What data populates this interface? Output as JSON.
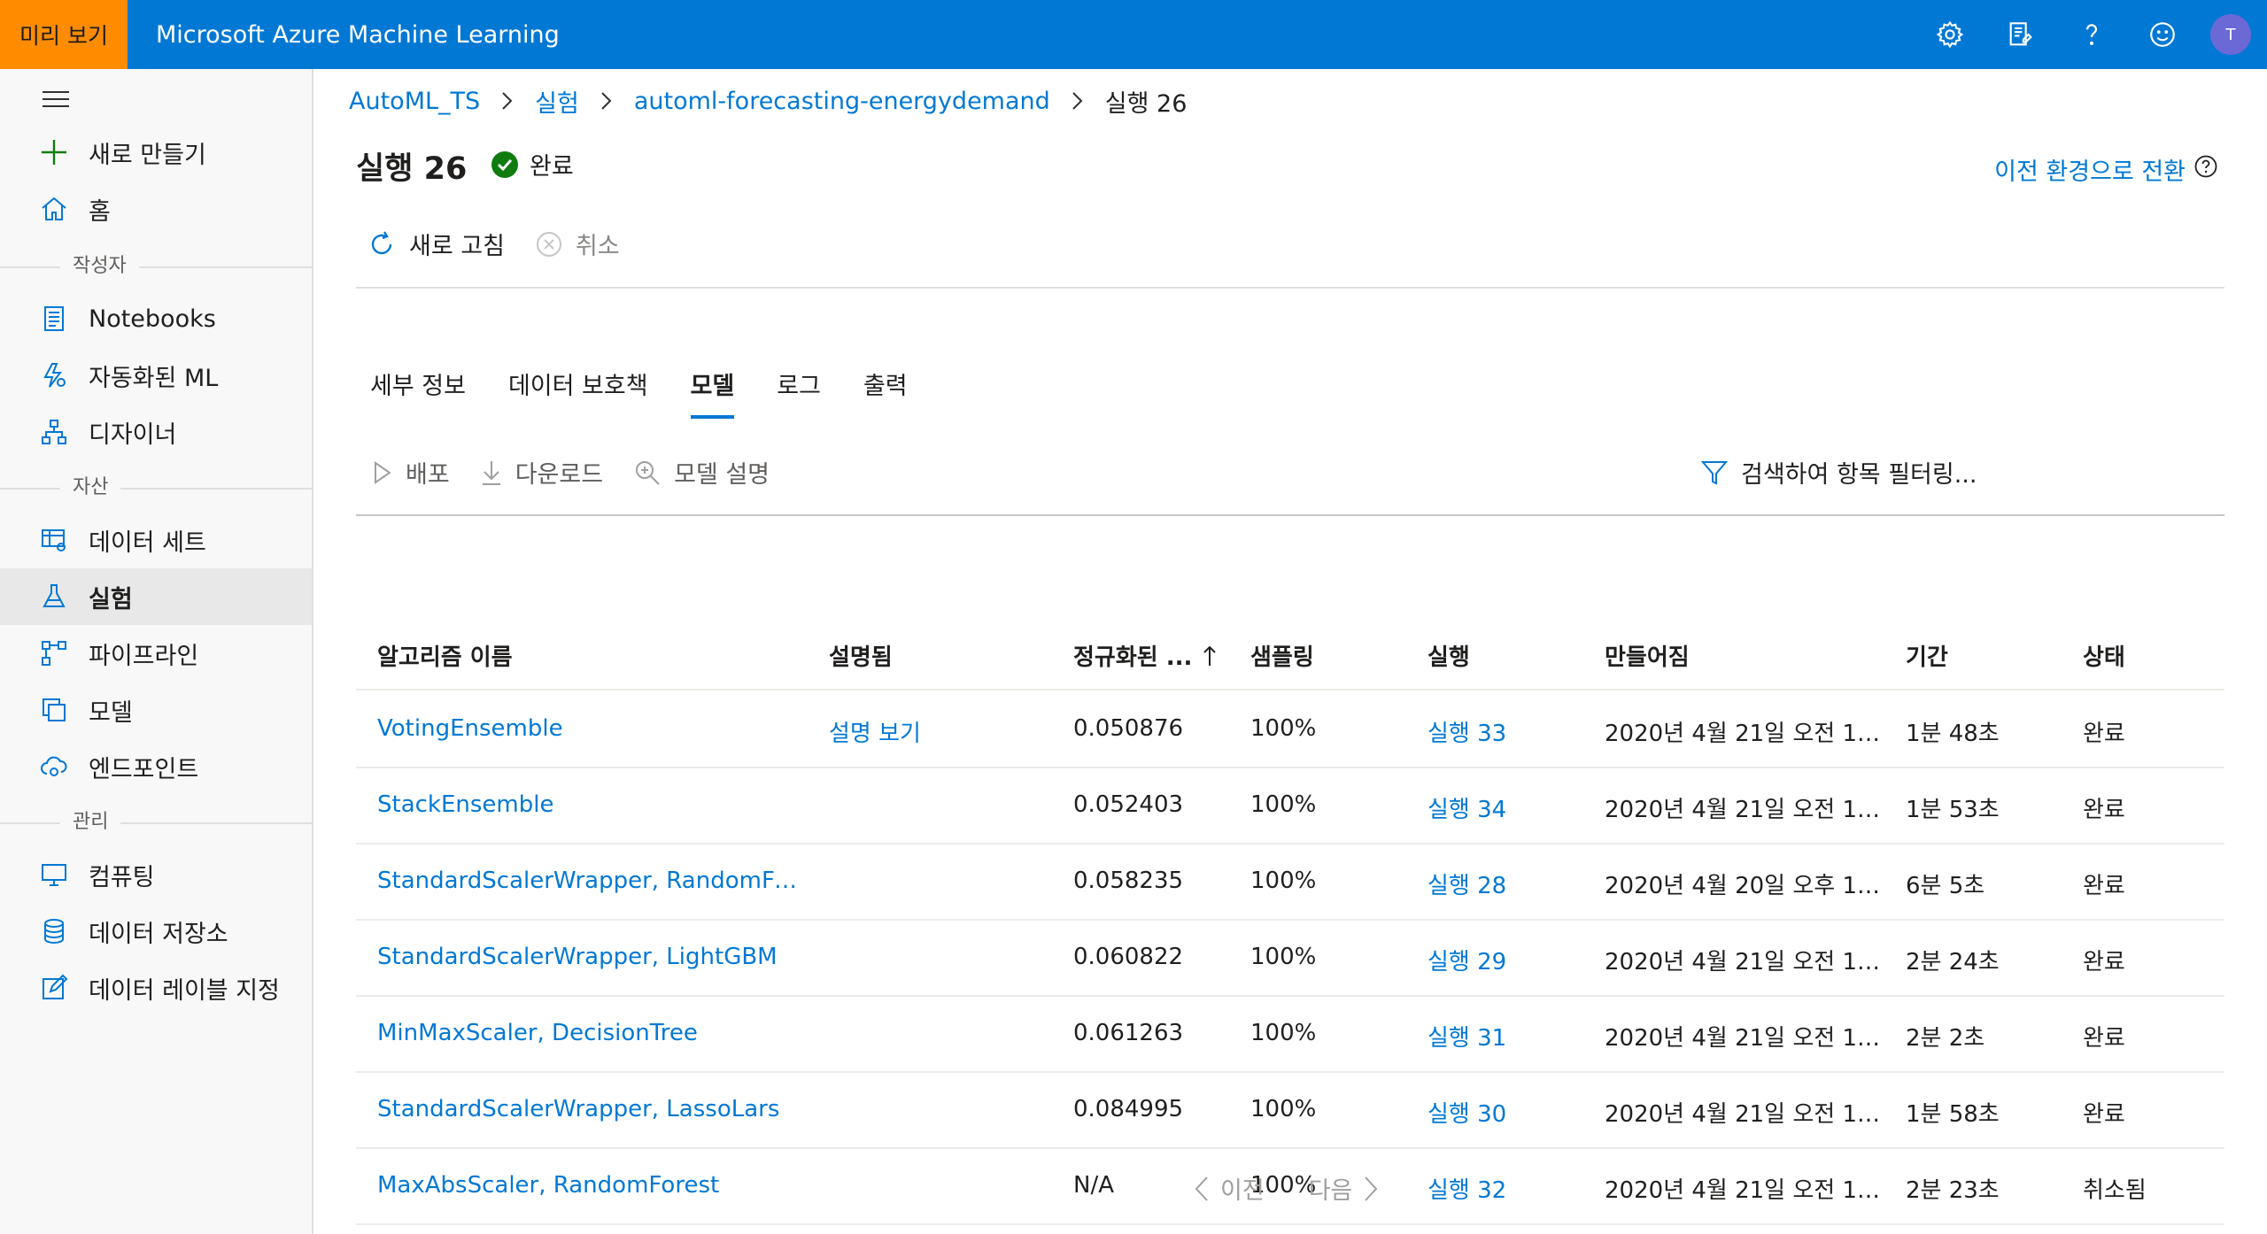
{
  "topbar": {
    "preview_label": "미리 보기",
    "app_title": "Microsoft Azure Machine Learning",
    "avatar_initial": "T",
    "icons": [
      "settings-icon",
      "feedback-icon",
      "help-icon",
      "smiley-icon"
    ]
  },
  "sidebar": {
    "new_label": "새로 만들기",
    "home_label": "홈",
    "groups": {
      "author": "작성자",
      "assets": "자산",
      "manage": "관리"
    },
    "items": {
      "notebooks": "Notebooks",
      "automl": "자동화된 ML",
      "designer": "디자이너",
      "datasets": "데이터 세트",
      "experiments": "실험",
      "pipelines": "파이프라인",
      "models": "모델",
      "endpoints": "엔드포인트",
      "compute": "컴퓨팅",
      "datastores": "데이터 저장소",
      "labeling": "데이터 레이블 지정"
    }
  },
  "breadcrumb": {
    "workspace": "AutoML_TS",
    "experiments": "실험",
    "experiment": "automl-forecasting-energydemand",
    "run": "실행 26"
  },
  "header": {
    "title": "실행 26",
    "status": "완료",
    "switch_link": "이전 환경으로 전환"
  },
  "commands": {
    "refresh": "새로 고침",
    "cancel": "취소"
  },
  "tabs": {
    "details": "세부 정보",
    "guardrails": "데이터 보호책",
    "models": "모델",
    "logs": "로그",
    "outputs": "출력"
  },
  "toolbar": {
    "deploy": "배포",
    "download": "다운로드",
    "explain": "모델 설명",
    "filter_placeholder": "검색하여 항목 필터링..."
  },
  "table": {
    "columns": {
      "algorithm": "알고리즘 이름",
      "explained": "설명됨",
      "metric": "정규화된 ...",
      "sampling": "샘플링",
      "run": "실행",
      "created": "만들어짐",
      "duration": "기간",
      "status": "상태"
    },
    "rows": [
      {
        "algorithm": "VotingEnsemble",
        "explained": "설명 보기",
        "metric": "0.050876",
        "sampling": "100%",
        "run": "실행 33",
        "created": "2020년 4월 21일 오전 12...",
        "duration": "1분 48초",
        "status": "완료"
      },
      {
        "algorithm": "StackEnsemble",
        "explained": "",
        "metric": "0.052403",
        "sampling": "100%",
        "run": "실행 34",
        "created": "2020년 4월 21일 오전 12...",
        "duration": "1분 53초",
        "status": "완료"
      },
      {
        "algorithm": "StandardScalerWrapper, RandomFor...",
        "explained": "",
        "metric": "0.058235",
        "sampling": "100%",
        "run": "실행 28",
        "created": "2020년 4월 20일 오후 11...",
        "duration": "6분 5초",
        "status": "완료"
      },
      {
        "algorithm": "StandardScalerWrapper, LightGBM",
        "explained": "",
        "metric": "0.060822",
        "sampling": "100%",
        "run": "실행 29",
        "created": "2020년 4월 21일 오전 12...",
        "duration": "2분 24초",
        "status": "완료"
      },
      {
        "algorithm": "MinMaxScaler, DecisionTree",
        "explained": "",
        "metric": "0.061263",
        "sampling": "100%",
        "run": "실행 31",
        "created": "2020년 4월 21일 오전 12...",
        "duration": "2분 2초",
        "status": "완료"
      },
      {
        "algorithm": "StandardScalerWrapper, LassoLars",
        "explained": "",
        "metric": "0.084995",
        "sampling": "100%",
        "run": "실행 30",
        "created": "2020년 4월 21일 오전 12...",
        "duration": "1분 58초",
        "status": "완료"
      },
      {
        "algorithm": "MaxAbsScaler, RandomForest",
        "explained": "",
        "metric": "N/A",
        "sampling": "100%",
        "run": "실행 32",
        "created": "2020년 4월 21일 오전 12...",
        "duration": "2분 23초",
        "status": "취소됨"
      }
    ]
  },
  "pager": {
    "prev": "이전",
    "next": "다음"
  },
  "colors": {
    "accent": "#0078d4",
    "preview": "#ff8c00",
    "success": "#107c10"
  }
}
